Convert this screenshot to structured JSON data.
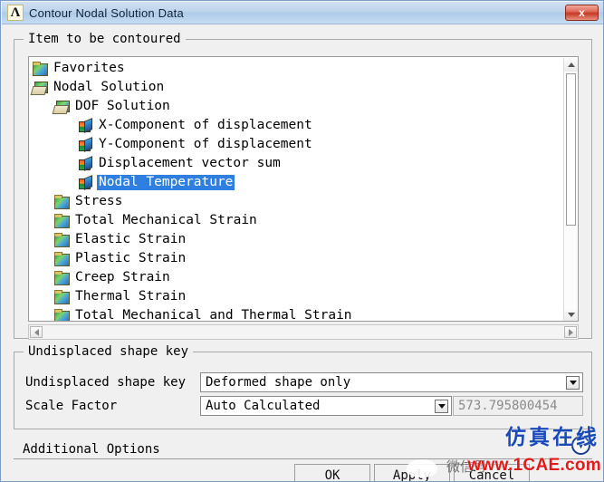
{
  "window": {
    "title": "Contour Nodal Solution Data",
    "app_icon": "ansys-lambda-icon",
    "close_label": "x"
  },
  "item_group": {
    "legend": "Item to be contoured",
    "tree": [
      {
        "label": "Favorites",
        "indent": 0,
        "icon": "folder-closed",
        "selected": false
      },
      {
        "label": "Nodal Solution",
        "indent": 0,
        "icon": "folder-open",
        "selected": false
      },
      {
        "label": "DOF Solution",
        "indent": 1,
        "icon": "folder-open",
        "selected": false
      },
      {
        "label": "X-Component of displacement",
        "indent": 2,
        "icon": "cube",
        "selected": false
      },
      {
        "label": "Y-Component of displacement",
        "indent": 2,
        "icon": "cube",
        "selected": false
      },
      {
        "label": "Displacement vector sum",
        "indent": 2,
        "icon": "cube",
        "selected": false
      },
      {
        "label": "Nodal Temperature",
        "indent": 2,
        "icon": "cube",
        "selected": true
      },
      {
        "label": "Stress",
        "indent": 1,
        "icon": "folder-closed",
        "selected": false
      },
      {
        "label": "Total Mechanical Strain",
        "indent": 1,
        "icon": "folder-closed",
        "selected": false
      },
      {
        "label": "Elastic Strain",
        "indent": 1,
        "icon": "folder-closed",
        "selected": false
      },
      {
        "label": "Plastic Strain",
        "indent": 1,
        "icon": "folder-closed",
        "selected": false
      },
      {
        "label": "Creep Strain",
        "indent": 1,
        "icon": "folder-closed",
        "selected": false
      },
      {
        "label": "Thermal Strain",
        "indent": 1,
        "icon": "folder-closed",
        "selected": false
      },
      {
        "label": "Total Mechanical and Thermal Strain",
        "indent": 1,
        "icon": "folder-closed",
        "selected": false
      }
    ]
  },
  "shape_group": {
    "legend": "Undisplaced shape key",
    "shape_key_label": "Undisplaced shape key",
    "shape_key_value": "Deformed shape only",
    "scale_factor_label": "Scale Factor",
    "scale_factor_value": "Auto Calculated",
    "scale_factor_number": "573.795800454"
  },
  "additional": {
    "label": "Additional Options",
    "expand_icon": "chevron-down-circle-icon"
  },
  "buttons": {
    "ok": "OK",
    "apply": "Apply",
    "cancel": "Cancel"
  },
  "watermarks": {
    "center": "1CAE.COM",
    "chinese": "仿真在线",
    "url": "www.1CAE.com",
    "wechat": "微信号"
  },
  "colors": {
    "selection": "#2f7fe0",
    "title_bar": "#bdd4ec",
    "close_button": "#c63a26",
    "watermark_red": "#e01b1b",
    "watermark_blue": "#1a49b8"
  }
}
